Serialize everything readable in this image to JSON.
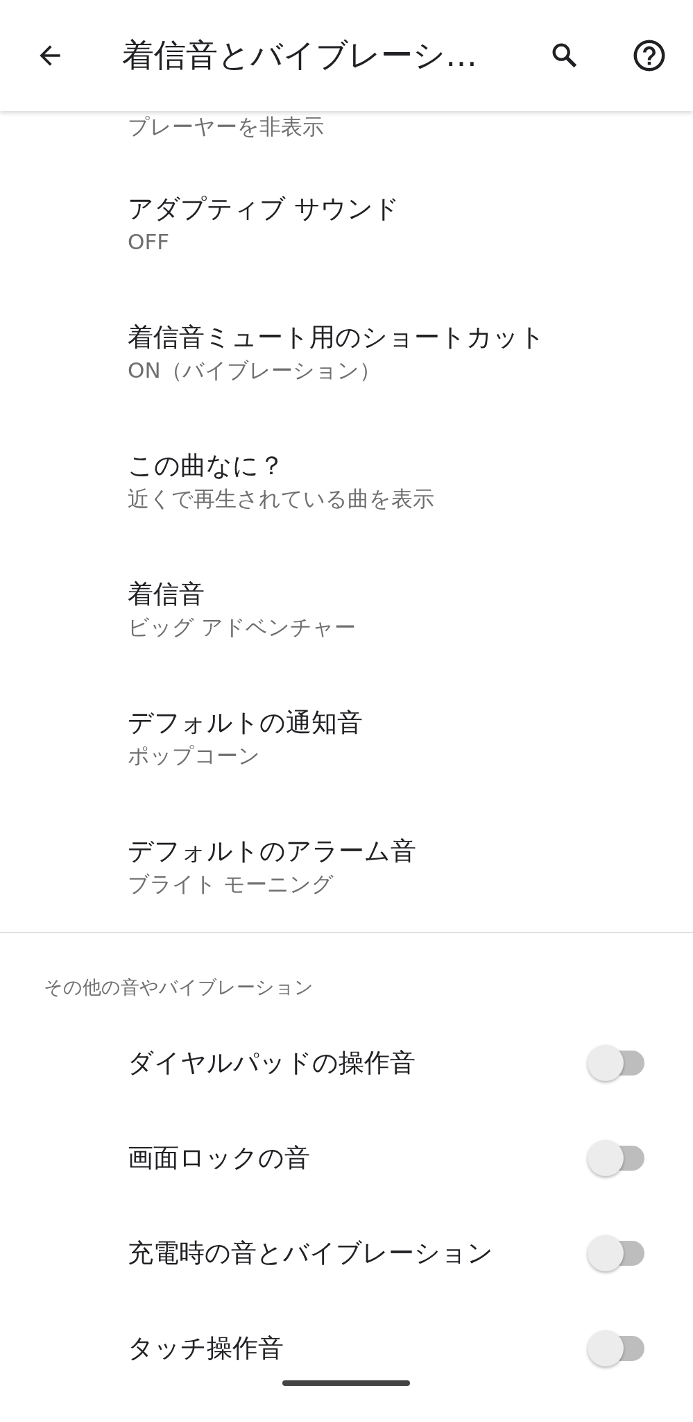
{
  "app_bar": {
    "title": "着信音とバイブレーシ…"
  },
  "partial_item": {
    "subtitle": "プレーヤーを非表示"
  },
  "items": [
    {
      "title": "アダプティブ サウンド",
      "subtitle": "OFF"
    },
    {
      "title": "着信音ミュート用のショートカット",
      "subtitle": "ON（バイブレーション）"
    },
    {
      "title": "この曲なに？",
      "subtitle": "近くで再生されている曲を表示"
    },
    {
      "title": "着信音",
      "subtitle": "ビッグ アドベンチャー"
    },
    {
      "title": "デフォルトの通知音",
      "subtitle": "ポップコーン"
    },
    {
      "title": "デフォルトのアラーム音",
      "subtitle": "ブライト モーニング"
    }
  ],
  "section": {
    "header": "その他の音やバイブレーション",
    "toggles": [
      {
        "label": "ダイヤルパッドの操作音",
        "on": false
      },
      {
        "label": "画面ロックの音",
        "on": false
      },
      {
        "label": "充電時の音とバイブレーション",
        "on": false
      },
      {
        "label": "タッチ操作音",
        "on": false
      }
    ]
  }
}
